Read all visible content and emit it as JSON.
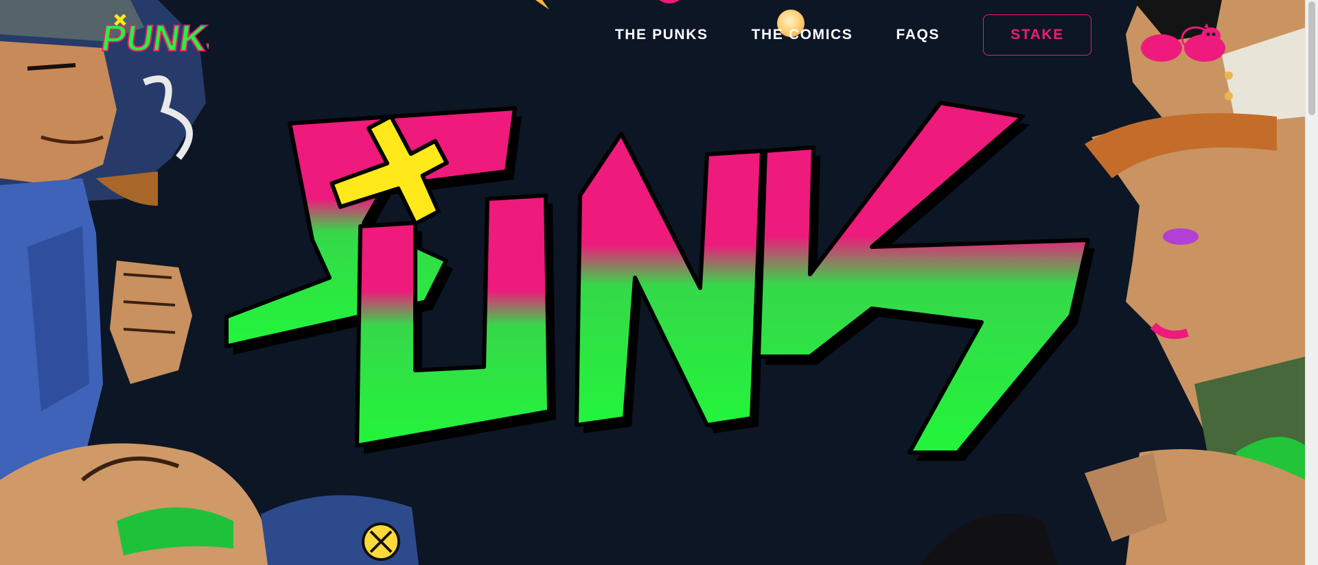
{
  "header": {
    "logo_text": "PUNKS",
    "nav": [
      {
        "label": "THE PUNKS"
      },
      {
        "label": "THE COMICS"
      },
      {
        "label": "FAQS"
      }
    ],
    "stake_label": "STAKE",
    "cart_icon": "pig-bank-icon"
  },
  "hero": {
    "logo_text": "PUNKS"
  },
  "colors": {
    "background": "#0c1625",
    "brand_pink": "#ee1a7c",
    "brand_green": "#22f53a",
    "brand_yellow": "#ffe91a",
    "white": "#ffffff"
  }
}
